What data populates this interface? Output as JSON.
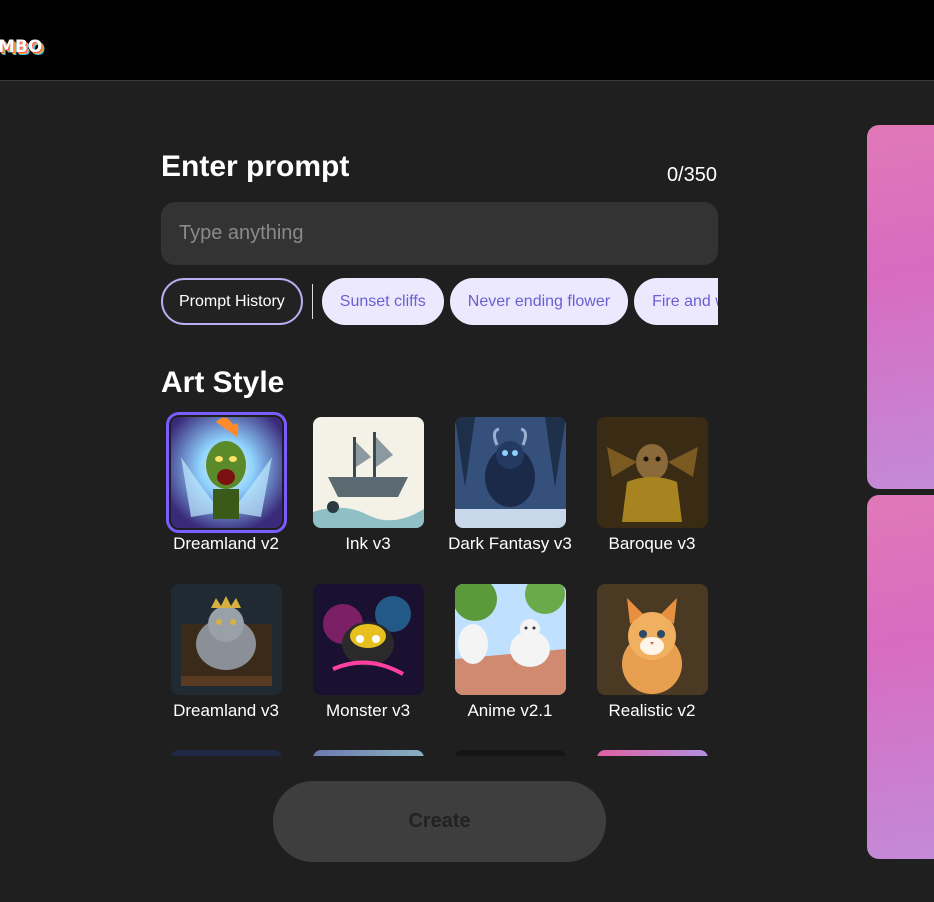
{
  "header": {
    "logo_text": "MBO"
  },
  "prompt": {
    "title": "Enter prompt",
    "counter": "0/350",
    "placeholder": "Type anything",
    "value": ""
  },
  "chips": {
    "history": "Prompt History",
    "suggestions": [
      "Sunset cliffs",
      "Never ending flower",
      "Fire and water"
    ]
  },
  "art_style": {
    "title": "Art Style",
    "selected": "Dreamland v2",
    "items": [
      {
        "label": "Dreamland v2",
        "icon": "dreamland-v2-thumbnail"
      },
      {
        "label": "Ink v3",
        "icon": "ink-v3-thumbnail"
      },
      {
        "label": "Dark Fantasy v3",
        "icon": "dark-fantasy-v3-thumbnail"
      },
      {
        "label": "Baroque v3",
        "icon": "baroque-v3-thumbnail"
      },
      {
        "label": "Dreamland v3",
        "icon": "dreamland-v3-thumbnail"
      },
      {
        "label": "Monster v3",
        "icon": "monster-v3-thumbnail"
      },
      {
        "label": "Anime v2.1",
        "icon": "anime-v21-thumbnail"
      },
      {
        "label": "Realistic v2",
        "icon": "realistic-v2-thumbnail"
      }
    ]
  },
  "actions": {
    "create_label": "Create"
  },
  "colors": {
    "accent": "#7b5cff",
    "chip_bg": "#ece9ff",
    "chip_text": "#6b5fd0",
    "background": "#1f1f1f"
  }
}
